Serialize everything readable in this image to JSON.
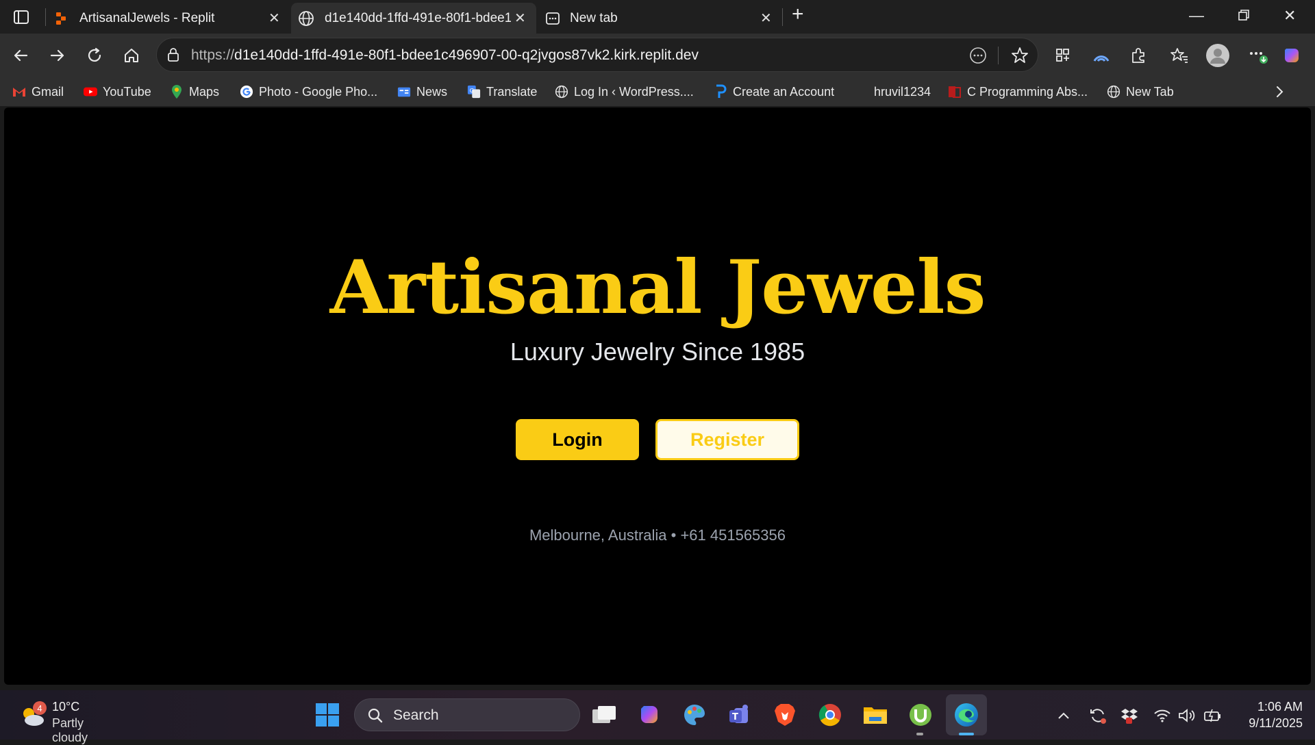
{
  "browser": {
    "tabs": [
      {
        "title": "ArtisanalJewels - Replit"
      },
      {
        "title": "d1e140dd-1ffd-491e-80f1-bdee1c496907-00-q2jvgos87vk2.kirk.replit.dev"
      },
      {
        "title": "New tab"
      }
    ],
    "address": {
      "scheme": "https://",
      "host": "d1e140dd-1ffd-491e-80f1-bdee1c496907-00-q2jvgos87vk2.kirk.replit.dev"
    },
    "bookmarks": [
      {
        "label": "Gmail"
      },
      {
        "label": "YouTube"
      },
      {
        "label": "Maps"
      },
      {
        "label": "Photo - Google Pho..."
      },
      {
        "label": "News"
      },
      {
        "label": "Translate"
      },
      {
        "label": "Log In ‹ WordPress...."
      },
      {
        "label": "Create an Account"
      },
      {
        "label": "hruvil1234"
      },
      {
        "label": "C Programming Abs..."
      },
      {
        "label": "New Tab"
      }
    ]
  },
  "page": {
    "brand": "Artisanal Jewels",
    "tagline": "Luxury Jewelry Since 1985",
    "login_label": "Login",
    "register_label": "Register",
    "contact": "Melbourne, Australia • +61 451565356"
  },
  "taskbar": {
    "weather_temp": "10°C",
    "weather_cond": "Partly cloudy",
    "weather_badge": "4",
    "search_label": "Search",
    "time": "1:06 AM",
    "date": "9/11/2025"
  },
  "colors": {
    "accent": "#facc15",
    "page_bg": "#000000",
    "muted_text": "#9ca3af"
  }
}
